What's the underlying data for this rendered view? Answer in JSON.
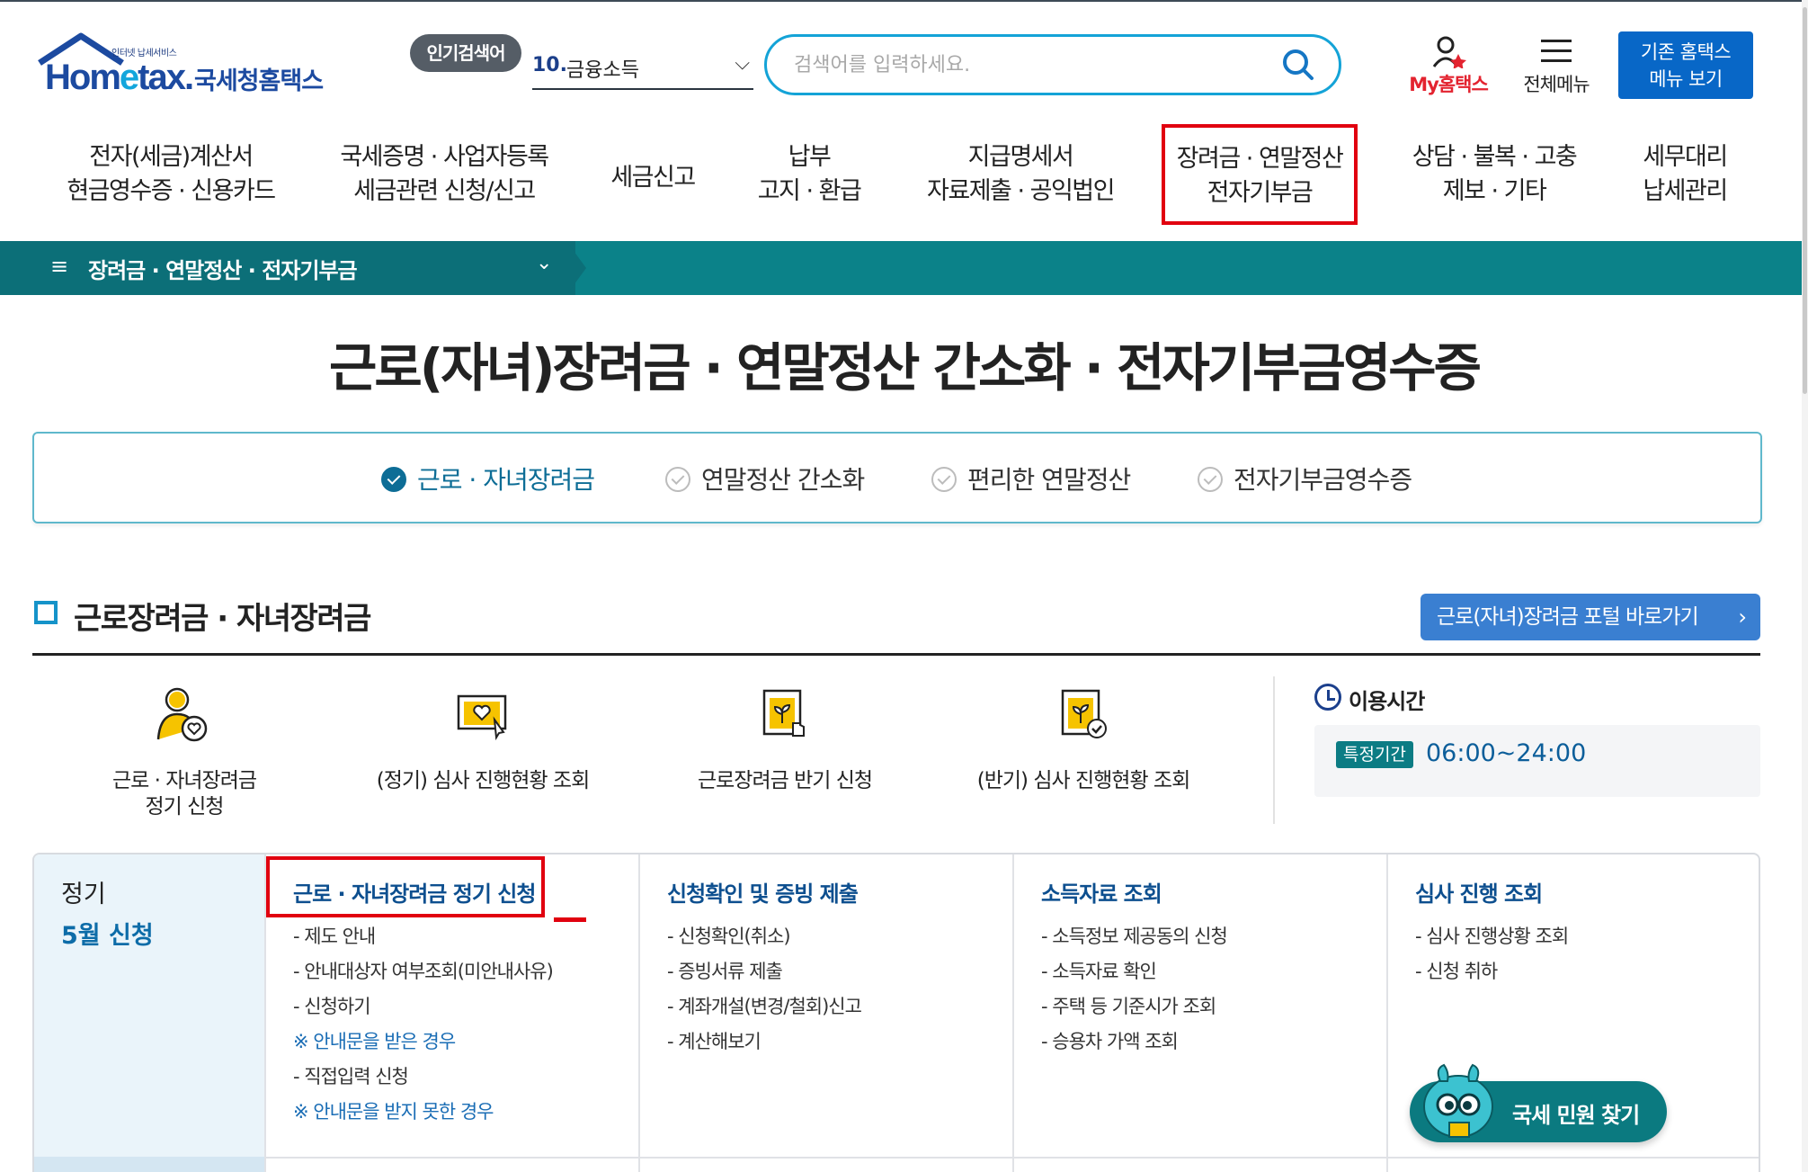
{
  "header": {
    "logo_small": "인터넷 납세서비스",
    "logo_word_a": "Hom",
    "logo_word_e": "e",
    "logo_word_b": "tax.",
    "logo_kor": "국세청홈택스",
    "popular_badge": "인기검색어",
    "popular_num": "10.",
    "popular_value": "금융소득",
    "search_placeholder": "검색어를 입력하세요.",
    "my_hometax": "My홈택스",
    "all_menu": "전체메뉴",
    "old_menu_line1": "기존 홈택스",
    "old_menu_line2": "메뉴 보기"
  },
  "gnb": [
    {
      "l1": "전자(세금)계산서",
      "l2": "현금영수증 · 신용카드"
    },
    {
      "l1": "국세증명 · 사업자등록",
      "l2": "세금관련 신청/신고"
    },
    {
      "l1": "세금신고",
      "l2": ""
    },
    {
      "l1": "납부",
      "l2": "고지 · 환급"
    },
    {
      "l1": "지급명세서",
      "l2": "자료제출 · 공익법인"
    },
    {
      "l1": "장려금 · 연말정산",
      "l2": "전자기부금"
    },
    {
      "l1": "상담 · 불복 · 고충",
      "l2": "제보 · 기타"
    },
    {
      "l1": "세무대리",
      "l2": "납세관리"
    }
  ],
  "breadcrumb": {
    "label": "장려금 · 연말정산 · 전자기부금"
  },
  "page_title": "근로(자녀)장려금 · 연말정산 간소화 · 전자기부금영수증",
  "tabs": [
    "근로 · 자녀장려금",
    "연말정산 간소화",
    "편리한 연말정산",
    "전자기부금영수증"
  ],
  "section": {
    "title": "근로장려금 · 자녀장려금",
    "portal_button": "근로(자녀)장려금 포털 바로가기"
  },
  "quick_links": [
    {
      "l1": "근로 · 자녀장려금",
      "l2": "정기 신청"
    },
    {
      "l1": "(정기) 심사 진행현황 조회",
      "l2": ""
    },
    {
      "l1": "근로장려금 반기 신청",
      "l2": ""
    },
    {
      "l1": "(반기) 심사 진행현황 조회",
      "l2": ""
    }
  ],
  "usetime": {
    "title": "이용시간",
    "badge": "특정기간",
    "time": "06:00~24:00"
  },
  "grid": {
    "left_title": "정기",
    "left_sub": "5월 신청",
    "columns": [
      {
        "head": "근로 · 자녀장려금 정기 신청",
        "items": [
          "- 제도 안내",
          "- 안내대상자 여부조회(미안내사유)",
          "- 신청하기",
          "※ 안내문을 받은 경우",
          "- 직접입력 신청",
          "※ 안내문을 받지 못한 경우"
        ]
      },
      {
        "head": "신청확인 및 증빙 제출",
        "items": [
          "- 신청확인(취소)",
          "- 증빙서류 제출",
          "- 계좌개설(변경/철회)신고",
          "- 계산해보기"
        ]
      },
      {
        "head": "소득자료 조회",
        "items": [
          "- 소득정보 제공동의 신청",
          "- 소득자료 확인",
          "- 주택 등 기준시가 조회",
          "- 승용차 가액 조회"
        ]
      },
      {
        "head": "심사 진행 조회",
        "items": [
          "- 심사 진행상황 조회",
          "- 신청 취하"
        ]
      }
    ]
  },
  "fab": {
    "label": "국세 민원 찾기"
  },
  "colors": {
    "primary_blue": "#1c4aa0",
    "search_border": "#14a3d7",
    "teal_bar": "#0b8289",
    "highlight_red": "#e1000f",
    "button_blue": "#3a7fd1"
  }
}
